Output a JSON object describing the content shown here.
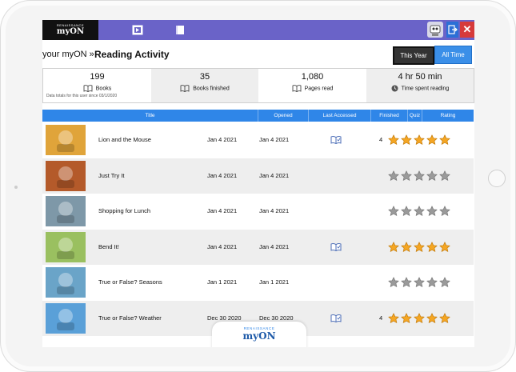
{
  "app": {
    "logo_small": "RENAISSANCE",
    "logo_big": "myON",
    "colors": {
      "topbar": "#6a63c8",
      "accent": "#2f86e8",
      "star": "#f5a623",
      "star_empty": "#9a9a9a"
    }
  },
  "header": {
    "breadcrumb": "your myON  »",
    "title": "Reading Activity",
    "filter_this_year": "This Year",
    "filter_all_time": "All Time"
  },
  "stats": {
    "books": {
      "value": "199",
      "label": "Books"
    },
    "books_finished": {
      "value": "35",
      "label": "Books finished"
    },
    "pages_read": {
      "value": "1,080",
      "label": "Pages read"
    },
    "time": {
      "value": "4 hr 50 min",
      "label": "Time spent reading"
    },
    "note": "Data totals for this user since 03/1/2020"
  },
  "table": {
    "columns": [
      "Title",
      "Opened",
      "Last Accessed",
      "Finished",
      "Quiz",
      "Rating"
    ],
    "rows": [
      {
        "title": "Lion and the Mouse",
        "opened": "Jan 4 2021",
        "last_accessed": "Jan 4 2021",
        "finished": true,
        "quiz": "4",
        "rating": 5,
        "cover_color": "#e0a43a"
      },
      {
        "title": "Just Try It",
        "opened": "Jan 4 2021",
        "last_accessed": "Jan 4 2021",
        "finished": false,
        "quiz": "",
        "rating": 0,
        "cover_color": "#b45a2a"
      },
      {
        "title": "Shopping for Lunch",
        "opened": "Jan 4 2021",
        "last_accessed": "Jan 4 2021",
        "finished": false,
        "quiz": "",
        "rating": 0,
        "cover_color": "#7e98a8"
      },
      {
        "title": "Bend It!",
        "opened": "Jan 4 2021",
        "last_accessed": "Jan 4 2021",
        "finished": true,
        "quiz": "",
        "rating": 5,
        "cover_color": "#9ac060"
      },
      {
        "title": "True or False? Seasons",
        "opened": "Jan 1 2021",
        "last_accessed": "Jan 1 2021",
        "finished": false,
        "quiz": "",
        "rating": 0,
        "cover_color": "#6aa4c8"
      },
      {
        "title": "True or False? Weather",
        "opened": "Dec 30 2020",
        "last_accessed": "Dec 30 2020",
        "finished": true,
        "quiz": "4",
        "rating": 5,
        "cover_color": "#5aa0d8"
      }
    ]
  },
  "footer": {
    "brand_small": "RENAISSANCE",
    "brand_big": "myON"
  }
}
